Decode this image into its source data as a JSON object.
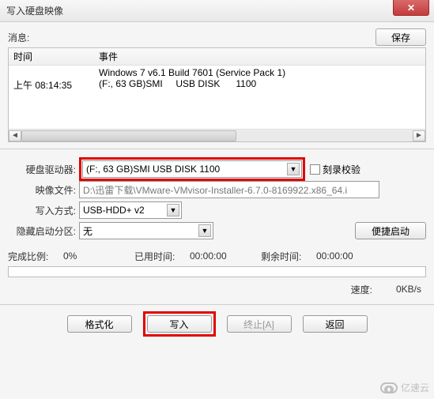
{
  "window": {
    "title": "写入硬盘映像",
    "close_glyph": "✕"
  },
  "top": {
    "message_label": "消息:",
    "save_label": "保存"
  },
  "log": {
    "header_time": "时间",
    "header_event": "事件",
    "rows": [
      {
        "time": "",
        "event": "Windows 7 v6.1 Build 7601 (Service Pack 1)"
      },
      {
        "time": "上午 08:14:35",
        "event": "(F:, 63 GB)SMI     USB DISK      1100"
      }
    ]
  },
  "form": {
    "drive_label": "硬盘驱动器:",
    "drive_value": "(F:, 63 GB)SMI     USB DISK      1100",
    "verify_label": "刻录校验",
    "image_label": "映像文件:",
    "image_value": "D:\\迅雷下载\\VMware-VMvisor-Installer-6.7.0-8169922.x86_64.i",
    "method_label": "写入方式:",
    "method_value": "USB-HDD+ v2",
    "hidden_label": "隐藏启动分区:",
    "hidden_value": "无",
    "portable_label": "便捷启动"
  },
  "status": {
    "progress_label": "完成比例:",
    "progress_value": "0%",
    "elapsed_label": "已用时间:",
    "elapsed_value": "00:00:00",
    "remaining_label": "剩余时间:",
    "remaining_value": "00:00:00",
    "speed_label": "速度:",
    "speed_value": "0KB/s"
  },
  "footer": {
    "format_label": "格式化",
    "write_label": "写入",
    "abort_label": "终止[A]",
    "return_label": "返回"
  },
  "watermark": "亿速云"
}
